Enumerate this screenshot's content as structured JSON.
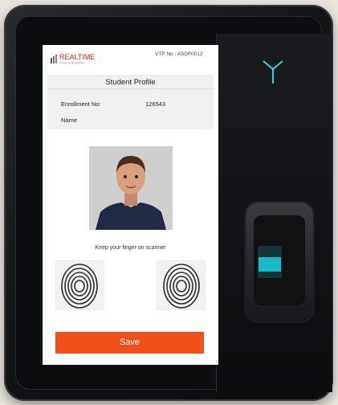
{
  "header": {
    "logo_text": "REALTIME",
    "logo_tagline": "Power of Biometrics",
    "vtp_text": "VTP No : ASDF0012"
  },
  "profile": {
    "title": "Student Profile",
    "enrollment_label": "Enrollment No:",
    "enrollment_value": "126543",
    "name_label": "Name"
  },
  "instruction": "Keep your finger on scanner",
  "actions": {
    "save_label": "Save"
  },
  "colors": {
    "accent": "#f1501b",
    "scanner_light": "#19b9c8",
    "indicator": "#2ed3e3"
  },
  "icons": {
    "left_fingerprint": "fingerprint-icon",
    "right_fingerprint": "fingerprint-icon",
    "device_indicator": "y-indicator-icon"
  }
}
